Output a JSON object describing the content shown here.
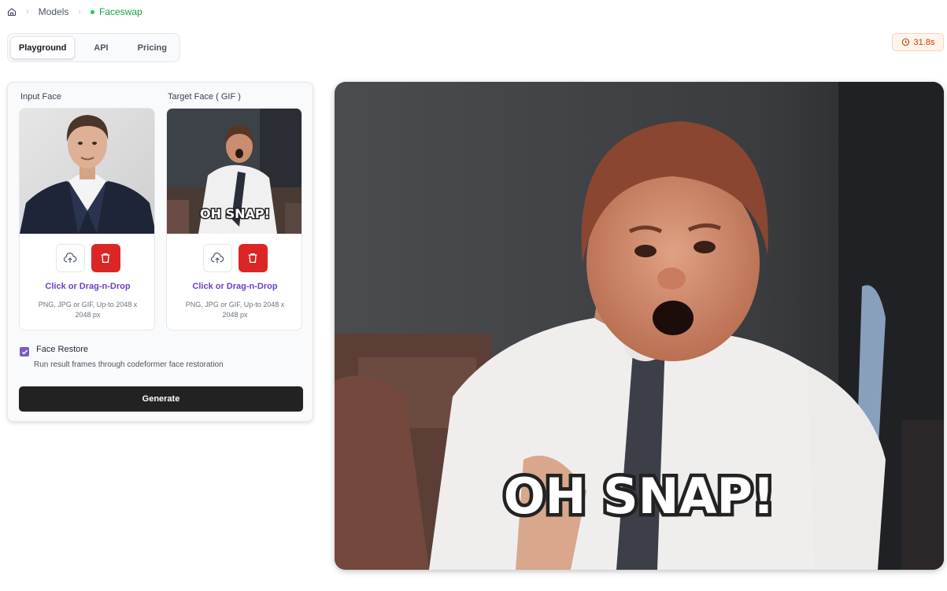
{
  "breadcrumb": {
    "home_icon": "home-icon",
    "models": "Models",
    "current": "Faceswap",
    "sep": "›"
  },
  "tabs": [
    {
      "label": "Playground",
      "active": true
    },
    {
      "label": "API",
      "active": false
    },
    {
      "label": "Pricing",
      "active": false
    }
  ],
  "timer": {
    "icon": "clock-icon",
    "value": "31.8s"
  },
  "input_face": {
    "label": "Input Face",
    "drop_text": "Click or Drag-n-Drop",
    "hint": "PNG, JPG or GIF, Up-to 2048 x 2048 px"
  },
  "target_face": {
    "label": "Target Face ( GIF )",
    "drop_text": "Click or Drag-n-Drop",
    "hint": "PNG, JPG or GIF, Up-to 2048 x 2048 px",
    "caption": "OH SNAP!"
  },
  "face_restore": {
    "checked": true,
    "label": "Face Restore",
    "description": "Run result frames through codeformer face restoration"
  },
  "generate_label": "Generate",
  "result": {
    "caption": "OH SNAP!"
  },
  "colors": {
    "accent": "#6d3fc9",
    "delete": "#dc2626",
    "status": "#16a34a"
  }
}
